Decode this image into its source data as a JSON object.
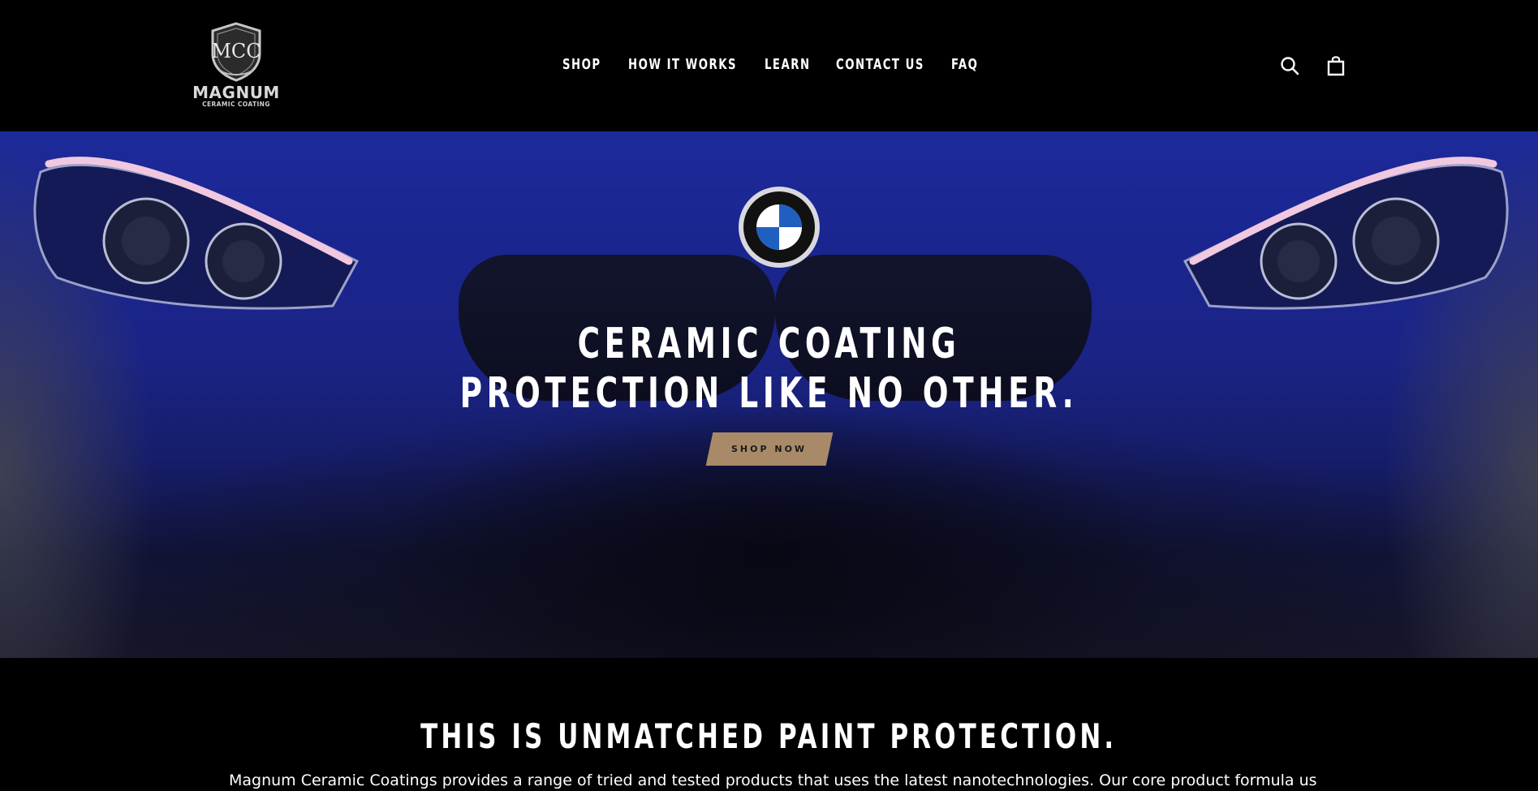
{
  "brand": {
    "monogram": "MCC",
    "name": "MAGNUM",
    "tagline": "CERAMIC COATING"
  },
  "nav": {
    "items": [
      {
        "label": "SHOP"
      },
      {
        "label": "HOW IT WORKS"
      },
      {
        "label": "LEARN"
      },
      {
        "label": "CONTACT US"
      },
      {
        "label": "FAQ"
      }
    ]
  },
  "header_icons": {
    "search": "search-icon",
    "cart": "cart-icon"
  },
  "hero": {
    "title_line1": "CERAMIC COATING",
    "title_line2": "PROTECTION LIKE NO OTHER.",
    "cta_label": "SHOP NOW",
    "cta_color": "#a88a68"
  },
  "intro": {
    "heading": "THIS IS UNMATCHED PAINT PROTECTION.",
    "text": "Magnum Ceramic Coatings provides a range of tried and tested products that uses the latest nanotechnologies. Our core product formula uses"
  }
}
